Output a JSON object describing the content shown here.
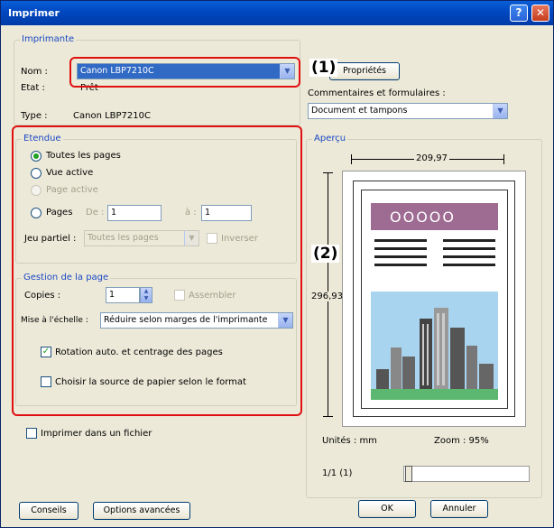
{
  "window": {
    "title": "Imprimer",
    "help_glyph": "?",
    "close_glyph": "✕"
  },
  "printer": {
    "group_label": "Imprimante",
    "name_label": "Nom :",
    "name_value": "Canon LBP7210C",
    "state_label": "Etat :",
    "state_value": "Prêt",
    "type_label": "Type :",
    "type_value": "Canon LBP7210C",
    "properties_button": "Propriétés",
    "comments_label": "Commentaires et formulaires :",
    "comments_value": "Document et tampons"
  },
  "range": {
    "group_label": "Etendue",
    "all_pages": "Toutes les pages",
    "current_view": "Vue active",
    "current_page": "Page active",
    "pages_label": "Pages",
    "from_label": "De :",
    "from_value": "1",
    "to_label": "à :",
    "to_value": "1",
    "subset_label": "Jeu partiel :",
    "subset_value": "Toutes les pages",
    "reverse_label": "Inverser"
  },
  "page_handling": {
    "group_label": "Gestion de la page",
    "copies_label": "Copies :",
    "copies_value": "1",
    "collate_label": "Assembler",
    "scaling_label": "Mise à l'échelle :",
    "scaling_value": "Réduire selon marges de l'imprimante",
    "auto_rotate_label": "Rotation auto. et centrage des pages",
    "auto_rotate_checked": true,
    "paper_source_label": "Choisir la source de papier selon le format",
    "paper_source_checked": false
  },
  "print_to_file_label": "Imprimer dans un fichier",
  "preview": {
    "group_label": "Aperçu",
    "width_value": "209,97",
    "height_value": "296,93",
    "units_label": "Unités : mm",
    "zoom_label": "Zoom : 95%",
    "page_counter": "1/1 (1)",
    "header_circles": "OOOOO"
  },
  "callouts": {
    "one": "(1)",
    "two": "(2)"
  },
  "buttons": {
    "tips": "Conseils",
    "advanced": "Options avancées",
    "ok": "OK",
    "cancel": "Annuler"
  },
  "colors": {
    "highlight": "#e01010",
    "selection": "#316ac5",
    "title_bar": "#0047c0"
  }
}
